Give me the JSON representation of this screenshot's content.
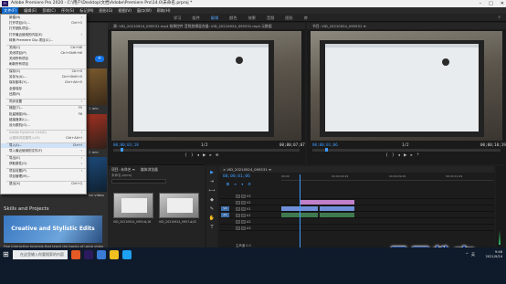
{
  "window": {
    "title": "Adobe Premiere Pro 2020 - C:\\用户\\Desktop\\文档\\Adobe\\Premiere Pro\\14.0\\未命名.prproj *",
    "controls": [
      "–",
      "□",
      "✕"
    ]
  },
  "menubar": {
    "items": [
      "文件(F)",
      "编辑(E)",
      "剪辑(C)",
      "序列(S)",
      "标记(M)",
      "图形(G)",
      "视图(V)",
      "窗口(W)",
      "帮助(H)"
    ]
  },
  "workspaces": {
    "tabs": [
      "学习",
      "组件",
      "编辑",
      "颜色",
      "效果",
      "音频",
      "图形",
      "库"
    ],
    "active": "编辑"
  },
  "file_menu": {
    "items": [
      {
        "label": "新建(N)",
        "shortcut": "",
        "arrow": true
      },
      {
        "label": "打开项目(O)...",
        "shortcut": "Ctrl+O"
      },
      {
        "label": "打开团队项目...",
        "shortcut": ""
      },
      {
        "label": "打开最近使用的内容(E)",
        "shortcut": "",
        "arrow": true
      },
      {
        "label": "转换 Premiere Clip 项目(C)...",
        "shortcut": ""
      },
      {
        "label": "关闭(C)",
        "shortcut": "Ctrl+W"
      },
      {
        "label": "关闭项目(P)",
        "shortcut": "Ctrl+Shift+W"
      },
      {
        "label": "关闭所有项目",
        "shortcut": ""
      },
      {
        "label": "刷新所有项目",
        "shortcut": ""
      },
      {
        "label": "保存(S)",
        "shortcut": "Ctrl+S"
      },
      {
        "label": "另存为(A)...",
        "shortcut": "Ctrl+Shift+S"
      },
      {
        "label": "保存副本(Y)...",
        "shortcut": "Ctrl+Alt+S"
      },
      {
        "label": "全部保存",
        "shortcut": ""
      },
      {
        "label": "还原(R)",
        "shortcut": ""
      },
      {
        "label": "同步设置",
        "shortcut": "",
        "arrow": true
      },
      {
        "label": "捕捉(T)...",
        "shortcut": "F5"
      },
      {
        "label": "批量捕捉(B)...",
        "shortcut": "F6"
      },
      {
        "label": "链接媒体(L)...",
        "shortcut": ""
      },
      {
        "label": "设为脱机(O)...",
        "shortcut": ""
      },
      {
        "label": "Adobe Dynamic Link(K)",
        "shortcut": "",
        "arrow": true,
        "disabled": true
      },
      {
        "label": "从媒体浏览器导入(M)",
        "shortcut": "Ctrl+Alt+I",
        "disabled": true
      },
      {
        "label": "导入(I)...",
        "shortcut": "Ctrl+I",
        "highlight": true
      },
      {
        "label": "导入最近使用的文件(F)",
        "shortcut": "",
        "arrow": true
      },
      {
        "label": "导出(E)",
        "shortcut": "",
        "arrow": true
      },
      {
        "label": "获取属性(G)",
        "shortcut": "",
        "arrow": true
      },
      {
        "label": "项目设置(P)",
        "shortcut": "",
        "arrow": true
      },
      {
        "label": "项目管理(M)...",
        "shortcut": ""
      },
      {
        "label": "退出(X)",
        "shortcut": "Ctrl+Q"
      }
    ]
  },
  "learn_panel": {
    "side_labels": [
      "1 min",
      "2 min",
      "for video"
    ],
    "skills_title": "Skills and Projects",
    "card_title": "Creative and Stylistic Edits",
    "description": "Five interactive tutorials that teach the basics of using video effects, adding titles and transitions, adjusting audio and color correction"
  },
  "source_monitor": {
    "header": "源: VID_20210924_095531.mp4  效果控件  音频剪辑混合器: VID_20210924_095531.mp4  元数据",
    "timecode_left": "00;00;03;18",
    "fit": "1/2",
    "timecode_right": "00;00;07;07"
  },
  "program_monitor": {
    "header": "节目: VID_20210924_095531 ≡",
    "timecode_left": "00;00;01;06",
    "fit": "1/2",
    "timecode_right": "00;00;10;19"
  },
  "project_panel": {
    "tabs": [
      "项目: 未命名 ≡",
      "媒体浏览器"
    ],
    "path": "未命名.prproj",
    "clips": [
      {
        "name": "VID_20210924_0955...",
        "duration": "6;16"
      },
      {
        "name": "VID_20210924_0957...",
        "duration": "4;02"
      }
    ]
  },
  "tools": [
    "▶",
    "⇥",
    "⟷",
    "◆",
    "✎",
    "✋",
    "T"
  ],
  "timeline": {
    "header": "× VID_20210924_095531 ≡",
    "timecode": "00;00;01;06",
    "ruler": [
      "00;00",
      "00;00;04;29",
      "00;00;09;29",
      "00;00;14;29"
    ],
    "tracks": [
      {
        "id": "V3",
        "target": ""
      },
      {
        "id": "V2",
        "target": ""
      },
      {
        "id": "V1",
        "target": "V1"
      },
      {
        "id": "A1",
        "target": "A1"
      },
      {
        "id": "A2",
        "target": ""
      },
      {
        "id": "A3",
        "target": ""
      }
    ],
    "master_label": "主声道",
    "master_value": "0.0"
  },
  "taskbar": {
    "search_placeholder": "在这里输入你要搜索的内容",
    "time": "9:46",
    "date": "2021/9/24",
    "tray": [
      "^",
      "英"
    ]
  },
  "watermark": "最需教育",
  "colors": {
    "accent": "#3f9cff",
    "menu_highlight": "#cfe2f7",
    "clip_purple": "#c080c8",
    "clip_blue": "#6f8fd8",
    "watermark": "#0e3fa8"
  }
}
